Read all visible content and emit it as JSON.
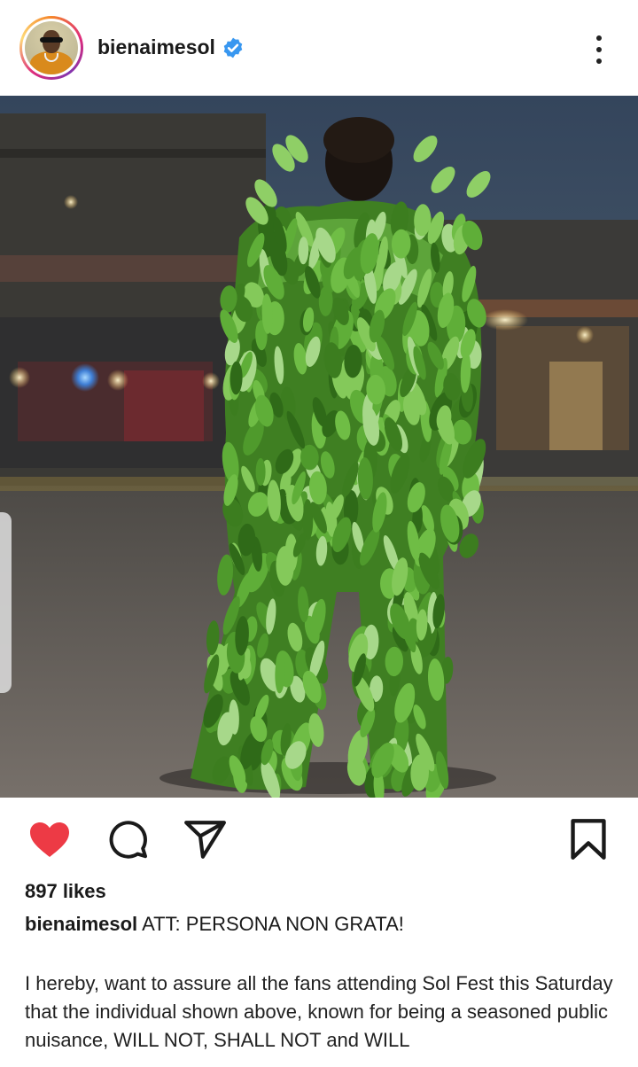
{
  "post": {
    "username": "bienaimesol",
    "verified": true,
    "likes": "897 likes",
    "caption_title": "ATT: PERSONA NON GRATA!",
    "caption_body": "I hereby, want to assure all the fans attending Sol Fest this Saturday that the individual shown above, known for being a seasoned public nuisance, WILL NOT, SHALL NOT and WILL",
    "liked": true
  },
  "colors": {
    "like_red": "#ed3a45",
    "verified_blue": "#3897f0",
    "leaf_green": "#4f9a2c"
  },
  "icons": {
    "more": "more-vertical-icon",
    "like": "heart-icon",
    "comment": "comment-icon",
    "share": "paper-plane-icon",
    "save": "bookmark-icon",
    "verified": "verified-badge-icon"
  }
}
